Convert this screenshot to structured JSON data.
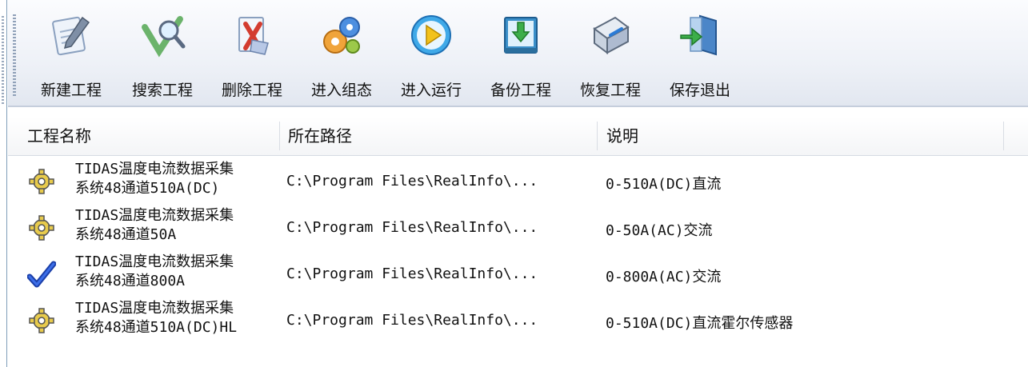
{
  "toolbar": {
    "buttons": [
      {
        "label": "新建工程",
        "icon": "new-project-icon"
      },
      {
        "label": "搜索工程",
        "icon": "search-project-icon"
      },
      {
        "label": "删除工程",
        "icon": "delete-project-icon"
      },
      {
        "label": "进入组态",
        "icon": "configure-icon"
      },
      {
        "label": "进入运行",
        "icon": "run-icon"
      },
      {
        "label": "备份工程",
        "icon": "backup-icon"
      },
      {
        "label": "恢复工程",
        "icon": "restore-icon"
      },
      {
        "label": "保存退出",
        "icon": "save-exit-icon"
      }
    ]
  },
  "table": {
    "columns": [
      "工程名称",
      "所在路径",
      "说明"
    ],
    "rows": [
      {
        "status": "gear-icon",
        "name_line1": "TIDAS温度电流数据采集",
        "name_line2": "系统48通道510A(DC)",
        "path": "C:\\Program Files\\RealInfo\\...",
        "desc": "0-510A(DC)直流"
      },
      {
        "status": "gear-icon",
        "name_line1": "TIDAS温度电流数据采集",
        "name_line2": "系统48通道50A",
        "path": "C:\\Program Files\\RealInfo\\...",
        "desc": "0-50A(AC)交流"
      },
      {
        "status": "checkmark-icon",
        "name_line1": "TIDAS温度电流数据采集",
        "name_line2": "系统48通道800A",
        "path": "C:\\Program Files\\RealInfo\\...",
        "desc": "0-800A(AC)交流"
      },
      {
        "status": "gear-icon",
        "name_line1": "TIDAS温度电流数据采集",
        "name_line2": "系统48通道510A(DC)HL",
        "path": "C:\\Program Files\\RealInfo\\...",
        "desc": "0-510A(DC)直流霍尔传感器"
      }
    ]
  },
  "colors": {
    "accent": "#1b4fcf",
    "gear": "#e7c84a",
    "border": "#7f9db9"
  }
}
